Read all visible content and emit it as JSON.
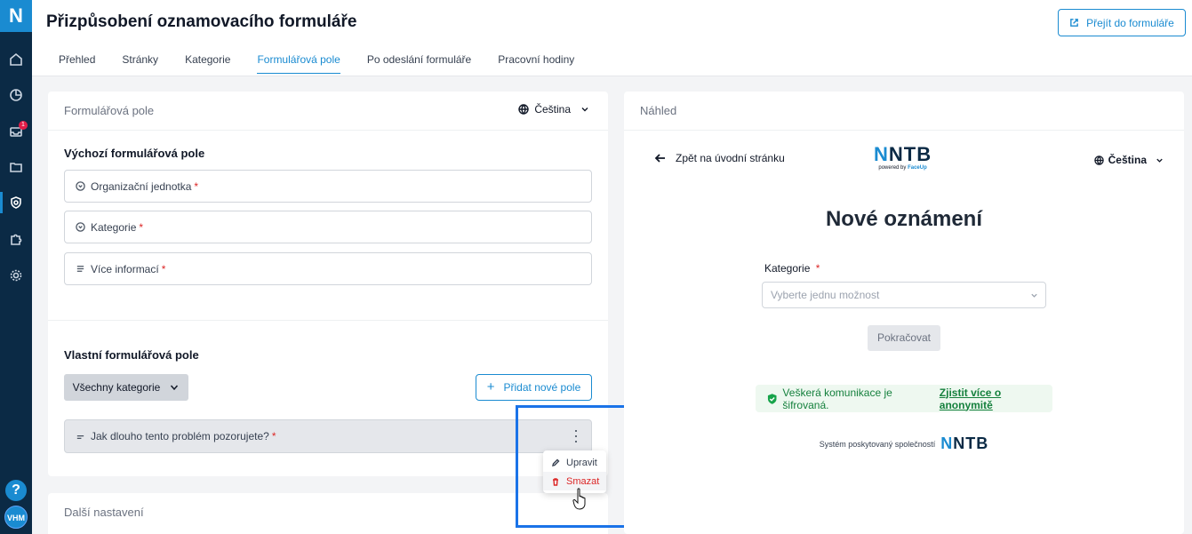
{
  "app": {
    "logo_letter": "N",
    "notification_count": "1",
    "help": "?",
    "avatar": "VHM"
  },
  "sidebar": {
    "icons": [
      "home-icon",
      "chart-icon",
      "inbox-icon",
      "folder-icon",
      "settings-shield-icon",
      "puzzle-icon",
      "gear-icon"
    ],
    "active_index": 4
  },
  "header": {
    "title": "Přizpůsobení oznamovacího formuláře",
    "goto_button": "Přejít do formuláře",
    "tabs": [
      {
        "label": "Přehled",
        "active": false
      },
      {
        "label": "Stránky",
        "active": false
      },
      {
        "label": "Kategorie",
        "active": false
      },
      {
        "label": "Formulářová pole",
        "active": true
      },
      {
        "label": "Po odeslání formuláře",
        "active": false
      },
      {
        "label": "Pracovní hodiny",
        "active": false
      }
    ]
  },
  "form_fields": {
    "panel_title": "Formulářová pole",
    "language": "Čeština",
    "default_title": "Výchozí formulářová pole",
    "default_fields": [
      {
        "label": "Organizační jednotka",
        "required": "*",
        "icon": "dropdown-circle-icon"
      },
      {
        "label": "Kategorie",
        "required": "*",
        "icon": "dropdown-circle-icon"
      },
      {
        "label": "Více informací",
        "required": "*",
        "icon": "text-lines-icon"
      }
    ],
    "custom_title": "Vlastní formulářová pole",
    "category_filter": "Všechny kategorie",
    "add_button": "Přidat nové pole",
    "custom_field": {
      "label": "Jak dlouho tento problém pozorujete?",
      "required": "*"
    },
    "menu": {
      "edit": "Upravit",
      "delete": "Smazat"
    }
  },
  "more_settings": {
    "title": "Další nastavení"
  },
  "preview": {
    "panel_title": "Náhled",
    "back": "Zpět na úvodní stránku",
    "brand_first": "N",
    "brand_rest": "NTB",
    "brand_powered": "powered by",
    "brand_faceup": "FaceUp",
    "language": "Čeština",
    "heading": "Nové oznámení",
    "category_label": "Kategorie",
    "category_required": "*",
    "select_placeholder": "Vyberte jednu možnost",
    "continue": "Pokračovat",
    "encryption_text": "Veškerá komunikace je šifrovaná.",
    "encryption_link": "Zjistit více o anonymitě",
    "provided_by": "Systém poskytovaný společností",
    "colors": {
      "accent": "#1a8bd1",
      "sidebar": "#0b2a45",
      "success": "#15803d",
      "danger": "#dc2626"
    }
  }
}
